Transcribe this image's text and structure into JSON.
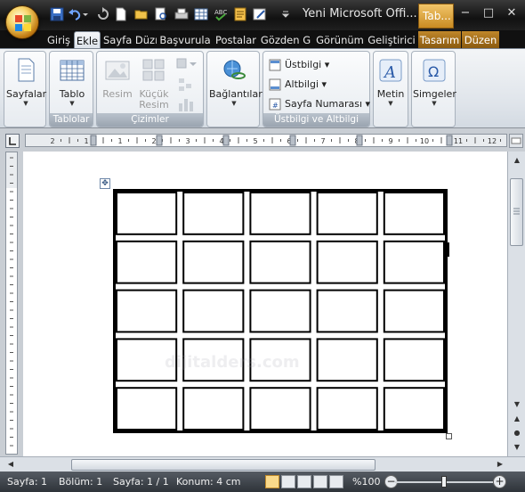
{
  "title_bar": {
    "document_title": "Yeni Microsoft Offi...",
    "context_tab": "Tab...",
    "window_buttons": [
      "−",
      "□",
      "✕"
    ]
  },
  "tabs": [
    {
      "label": "Giriş",
      "active": false
    },
    {
      "label": "Ekle",
      "active": true
    },
    {
      "label": "Sayfa Düzı",
      "active": false
    },
    {
      "label": "Başvurula",
      "active": false
    },
    {
      "label": "Postalar",
      "active": false
    },
    {
      "label": "Gözden G",
      "active": false
    },
    {
      "label": "Görünüm",
      "active": false
    },
    {
      "label": "Geliştirici",
      "active": false
    },
    {
      "label": "Tasarım",
      "active": false,
      "contextual": true
    },
    {
      "label": "Düzen",
      "active": false,
      "contextual": true
    }
  ],
  "help_label": "?",
  "ribbon": {
    "sayfalar": {
      "label": "Sayfalar"
    },
    "tablolar": {
      "group_label": "Tablolar",
      "tablo": "Tablo"
    },
    "cizimler": {
      "group_label": "Çizimler",
      "resim": "Resim",
      "kucuk_resim_1": "Küçük",
      "kucuk_resim_2": "Resim"
    },
    "baglantilar": {
      "label": "Bağlantılar"
    },
    "ustbilgi_group": {
      "group_label": "Üstbilgi ve Altbilgi",
      "ustbilgi": "Üstbilgi",
      "altbilgi": "Altbilgi",
      "sayfa_numarasi": "Sayfa Numarası"
    },
    "metin": {
      "label": "Metin"
    },
    "simgeler": {
      "label": "Simgeler"
    }
  },
  "ruler": {
    "numbers": [
      "2",
      "1",
      "1",
      "2",
      "3",
      "4",
      "5",
      "6",
      "7",
      "8",
      "9",
      "10",
      "11",
      "12"
    ]
  },
  "document": {
    "table": {
      "rows": 5,
      "cols": 5
    },
    "watermark": "dijitalders.com"
  },
  "status": {
    "page": "Sayfa: 1",
    "section": "Bölüm: 1",
    "page_of": "Sayfa: 1 / 1",
    "position": "Konum: 4 cm",
    "zoom": "%100"
  },
  "colors": {
    "ribbon_bg": "#e4e8ed",
    "titlebar_bg": "#1a1a1a",
    "context_tab": "#c98b22",
    "statusbar_bg": "#3a4047"
  }
}
